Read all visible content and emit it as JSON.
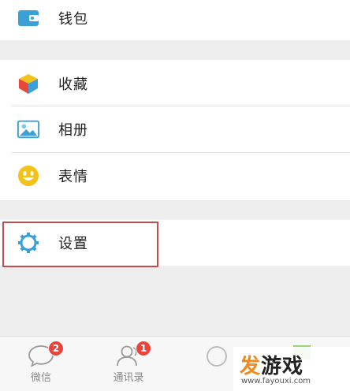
{
  "menu": {
    "wallet": {
      "label": "钱包",
      "icon": "wallet-icon"
    },
    "favorites": {
      "label": "收藏",
      "icon": "cube-icon"
    },
    "album": {
      "label": "相册",
      "icon": "picture-icon"
    },
    "stickers": {
      "label": "表情",
      "icon": "smiley-icon"
    },
    "settings": {
      "label": "设置",
      "icon": "gear-icon"
    }
  },
  "tabbar": {
    "tabs": [
      {
        "label": "微信",
        "badge": "2",
        "icon": "chat-bubble-icon"
      },
      {
        "label": "通讯录",
        "badge": "1",
        "icon": "contacts-icon"
      },
      {
        "label": "",
        "icon": "compass-icon"
      },
      {
        "label": "",
        "icon": "me-icon"
      }
    ]
  },
  "watermark": {
    "text_first": "发",
    "text_rest": "游戏",
    "url": "www.fayouxi.com"
  },
  "colors": {
    "background": "#eeeeef",
    "accent_blue": "#3aa0d8",
    "badge_red": "#e8453c",
    "highlight_red": "#c0504d"
  }
}
